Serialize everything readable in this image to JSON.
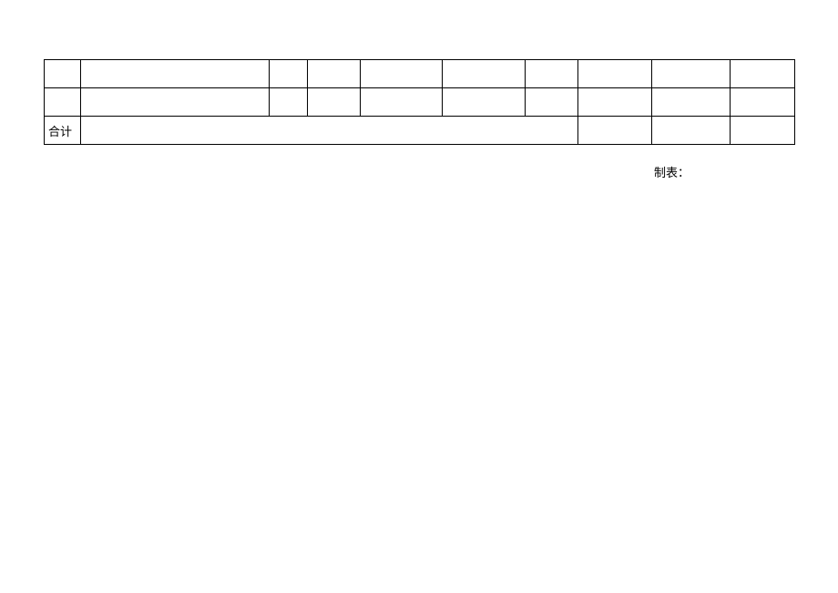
{
  "table": {
    "rows": [
      {
        "cells": [
          "",
          "",
          "",
          "",
          "",
          "",
          "",
          "",
          "",
          ""
        ]
      },
      {
        "cells": [
          "",
          "",
          "",
          "",
          "",
          "",
          "",
          "",
          "",
          ""
        ]
      }
    ],
    "totalRow": {
      "label": "合计",
      "mergedValue": "",
      "tail": [
        "",
        "",
        ""
      ]
    }
  },
  "footer": {
    "preparedBy": "制表："
  }
}
